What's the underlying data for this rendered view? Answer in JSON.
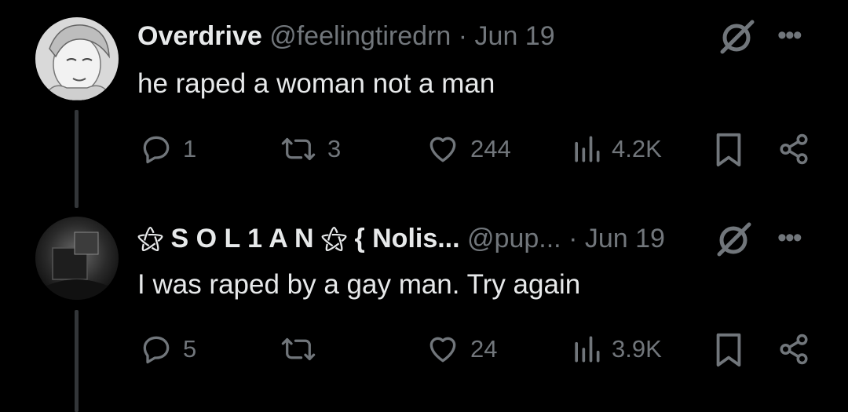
{
  "tweets": [
    {
      "display_name": "Overdrive",
      "handle": "@feelingtiredrn",
      "separator": "·",
      "date": "Jun 19",
      "text": "he raped a woman not a man",
      "more": "•••",
      "stats": {
        "replies": "1",
        "reposts": "3",
        "likes": "244",
        "views": "4.2K"
      }
    },
    {
      "display_name": "⚝ S O L 1 A N ⚝ { Nolis...",
      "handle": "@pup...",
      "separator": "·",
      "date": "Jun 19",
      "text": "I was raped by a gay man. Try again",
      "more": "•••",
      "stats": {
        "replies": "5",
        "reposts": "",
        "likes": "24",
        "views": "3.9K"
      }
    }
  ],
  "colors": {
    "background": "#000000",
    "text": "#e7e9ea",
    "muted": "#71767b",
    "thread_line": "#333639"
  },
  "icons": [
    "grok-icon",
    "more-icon",
    "reply-icon",
    "repost-icon",
    "like-icon",
    "views-icon",
    "bookmark-icon",
    "share-icon"
  ]
}
